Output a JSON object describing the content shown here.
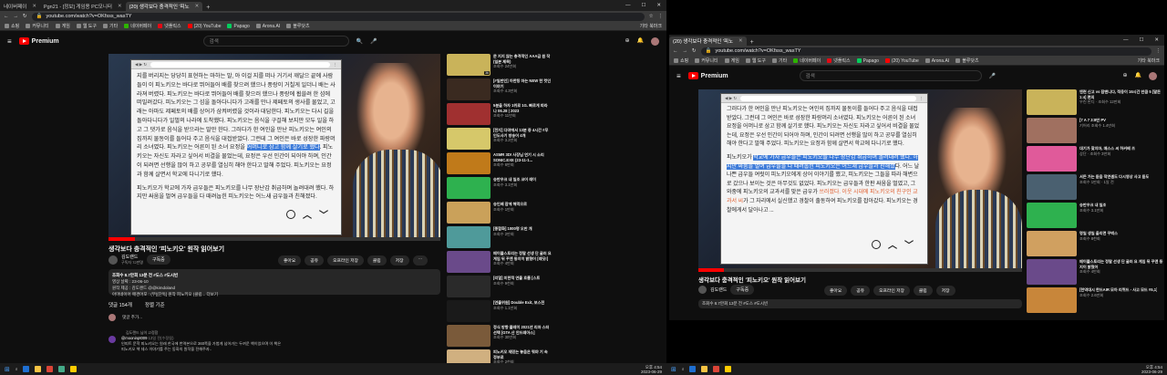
{
  "tabs": [
    {
      "label": "네이버페이"
    },
    {
      "label": "Pgn21 - [정보] 게임용 PC모니터"
    },
    {
      "label": "(20) 생각보다 충격적인 '피노"
    }
  ],
  "url": "youtube.com/watch?v=OKfsss_wasTY",
  "bookmarks": [
    "쇼핑",
    "커뮤니티",
    "게임",
    "웹 도구",
    "기타",
    "네이버페이",
    "넷플릭스",
    "(20) YouTube",
    "Papago",
    "Arona.AI",
    "블루닷츠"
  ],
  "bookmarks_right": "기타 북마크",
  "youtube": {
    "logo": "Premium",
    "search_placeholder": "검색"
  },
  "doc_left": [
    "지를 버리지는 당당히 표현하는 마하는 말, 아 이걸 지를 떠나 거기서 깨달으 끝에 사람들이 이 피노키오는 바다로 뛰어들어 배를 찾으려 했으나 풍랑이 거칠게 일더니 배는 사라져 버렸다. 피노키오는 바다로 뛰어들어 배를 찾으러 했으나 풍랑에 휩쓸려 한 섬에 떠밀려갔다. 피노키오는 그 섬을 돌아다니다가 고래를 만나 제페토의 생사를 물었고, 고래는 아마도 제페토의 배를 상어가 삼켜버렸을 것이라 대답한다. 피노키오는 다시 길을 돌아다니다가 일벌의 나라에 도착했다. 피노키오는 음식을 구걸해 보지만 모두 일을 하고 그 댓가로 음식을 받으라는 말만 한다. 그러다가 한 여인을 만난 피노키오는 여인의 집까지 물동이를 들어다 주고 음식을 대접받았다. 그런데 그 여인은 바로 성장한 파랑머리 소녀였다. 피노키오는 어른이 된 소녀 요정을 ",
    "어머니로 삼고 함께 살기로 했다",
    ". 피노키오는 자신도 자라고 싶어서 비결을 물었는데, 요정은 우선 인간이 되어야 하며, 인간이 되려면 선행을 많이 하고 공부를 열심히 해야 한다고 말해 주었다. 피노키오는 요정과 함께 살면서 학교에 다니기로 했다.",
    "피노키오가 학교에 가자 급우들은 피노키오를 나무 장난감 취급하며 놀려대려 했다. 하지만 싸움을 벌여 급우들을 다 때려눕힌 피노키오는 어느새 급우들과 친해졌다."
  ],
  "doc_right": [
    "그러다가 한 여인을 만난 피노키오는 여인의 집까지 물동이를 들어다 주고 음식을 대접받았다. 그런데 그 여인은 바로 성장한 파랑머리 소녀였다. 피노키오는 어른이 된 소녀 요정을 어머니로 삼고 함께 살기로 했다. 피노키오는 자신도 자라고 싶어서 비결을 물었는데, 요정은 우선 인간이 되어야 하며, 인간이 되려면 선행을 많이 하고 공부를 열심히 해야 한다고 말해 주었다. 피노키오는 요정과 함께 살면서 학교에 다니기로 했다.",
    "피노키오가 ",
    "학교에 가자 급우들은 피노키오를 나무 장난감 취급하며 놀려대려 했다. 하지만 싸움을 벌여 급우들을 다 때려눕힌 피노키오는 어느새 급우들과 친해졌",
    "다. 어느 날 나쁜 급우들 여럿이 피노키오에게 상어 이야기를 했고, 피노키오는 그들을 따라 해변으로 갔으나 보이는 것은 아무것도 없었다. 피노키오는 급우들과 한판 싸움을 벌였고, 그 와중에 피노키오의 교과서를 맞은 급우가 ",
    "쓰러졌다. 이웃 시대에 피노키오의 친구인 교과서 씨",
    "가 그 자리에서 실신했고 경찰이 출동하여 피노키오를 잡아갔다. 피노키오는 경찰에게서 달아나고 ..."
  ],
  "video": {
    "title": "생각보다 충격적인 '피노키오' 원작 읽어보기",
    "channel": "김도랜드",
    "subscribers": "구독자 72만명",
    "subscribe": "구독중",
    "likes": "좋아요",
    "share": "공유",
    "download": "오프라인 저장",
    "clip": "클립",
    "save": "저장",
    "more": "···"
  },
  "description": {
    "stats": "조회수 8.7만회 13분 전  #도스 #도시빈",
    "line2": "영상 날짜 : 23-06-10",
    "line3": "원작 제공 : 김도랜드 @@kimdoland",
    "line4": "아마네이어 매경어포 : (무)[단독] 원작 피노키오 (클립...  더보기"
  },
  "comments": {
    "count": "댓글 154개",
    "sort": "정렬 기준",
    "add": "댓글 추가...",
    "pinned": "김도랜드 님이 고정함",
    "author": "@mooninpt009",
    "author_time": "13일 전(수정됨)",
    "text1": "인피트 문학 피노키오는 원래 한국에 번역본으로 360쪽을 가볍게 넘어가는 두꺼운 책이었으며 이 책은",
    "text2": "피노키오 책 데스 이야기를 주는 동화의 원작을 전해주자.."
  },
  "sidebar_left": [
    {
      "title": "문 지지 않는 충격적인 AAA급 원 작 (일본 제목)",
      "meta": "조회수 24만회",
      "dur": "36",
      "color": "#c9b35a"
    },
    {
      "title": "[#일반인] 아한팅 마는 NEW 한 컷인 이야기",
      "meta": "조회수 4.3만회",
      "dur": "",
      "color": "#3a2a20"
    },
    {
      "title": "5분을 하자 1위로 1G. 빠르게 따라 나 06.28 | 2023",
      "meta": "조회수 11만회",
      "dur": "",
      "color": "#a03030"
    },
    {
      "title": "[전지] 다야에서 13분 중 4시간 #무 인도사기 방송어 4개",
      "meta": "조회수 3.2만회",
      "dur": "",
      "color": "#d6c86a"
    },
    {
      "title": "ASMR 3D! 사장님 연기 시 소리 SONIC.EXE (23-11-1...",
      "meta": "조회수 6만회",
      "dur": "",
      "color": "#c07a1a"
    },
    {
      "title": "승반우크 내 일조 코어 레이",
      "meta": "조회수 3.1만회",
      "dur": "",
      "color": "#2eb14f"
    },
    {
      "title": "승인배 잠에 해먹으르",
      "meta": "조회수 1만회",
      "dur": "",
      "color": "#caa15a"
    },
    {
      "title": "[종합화] 1000명 오만 개",
      "meta": "조회수 2만회",
      "dur": "",
      "color": "#4f9a9a"
    },
    {
      "title": "메이플스토리는 정말 선생 단 굴러 요 게임 뒤 꾸앤 동지이 밝혔어 [레딧!]",
      "meta": "조회수 4만회",
      "dur": "",
      "color": "#6a4a8a"
    },
    {
      "title": "[리얼] 미한적 연출 흐름 [스트",
      "meta": "조회수 9천회",
      "dur": "",
      "color": "#2a2a2a"
    },
    {
      "title": "[연출위원] Double Exit, 보스전",
      "meta": "조회수 1.1만회",
      "dur": "",
      "color": "#1a1a1a"
    },
    {
      "title": "정식 방향 플레이 2021년 리마 스터 선택 [GTA 산 안드레아스]",
      "meta": "조회수 30만회",
      "dur": "",
      "color": "#7a5a3a"
    },
    {
      "title": "피노키오 재밌는 놓음은 뭐야 기 속 정부로",
      "meta": "조회수 2천회",
      "dur": "",
      "color": "#d0b080"
    }
  ],
  "sidebar_right": [
    {
      "title": "엔련 신고 vs 잠맨니다, 적응이 16시간 만큼 5 [말돈 1:4] 편의",
      "meta": "우린 만디 · 조회수 12만회",
      "dur": "",
      "color": "#c9b35a"
    },
    {
      "title": "[7 A 7 3:8만 PV",
      "meta": "기어리 조회수 1.4만회",
      "dur": "",
      "color": "#a07060"
    },
    {
      "title": "대기가 찾지마, 매스스 씨 하커베 즈",
      "meta": "상단 · 조회수 3만회",
      "dur": "",
      "color": "#e05a9a"
    },
    {
      "title": "서든 가는 듣음 작연셈도 다시영상 사고 듣도",
      "meta": "조회수 1만회 · 1일 전",
      "dur": "",
      "color": "#4a6070"
    },
    {
      "title": "승반우크 내 일조",
      "meta": "조회수 3.1만회",
      "dur": "",
      "color": "#2eb14f"
    },
    {
      "title": "명일 생일 올리면 꾸벅스",
      "meta": "조회수 8천회",
      "dur": "",
      "color": "#d0a060"
    },
    {
      "title": "메이플스토리는 정말 선생 단 굴러 요 게임 뒤 꾸앤 동지이 밝혔어",
      "meta": "조회수 4만회",
      "dur": "",
      "color": "#6a4a8a"
    },
    {
      "title": "[한역대시 한드AIR 모아 리퀴드 - 사고 모드 #5,1]",
      "meta": "조회수 2.6만회",
      "dur": "",
      "color": "#c8863a"
    }
  ],
  "video_right": {
    "title": "생각보다 충격적인 '피노키오' 원작 읽어보기",
    "channel": "김도랜드",
    "stats": "조회수 8.7만회 13분 전  #도스 #도시빈"
  },
  "clock_left": {
    "time": "오후 4:54",
    "date": "2023-06-29"
  },
  "clock_right": {
    "time": "오후 4:54",
    "date": "2023-06-29"
  }
}
